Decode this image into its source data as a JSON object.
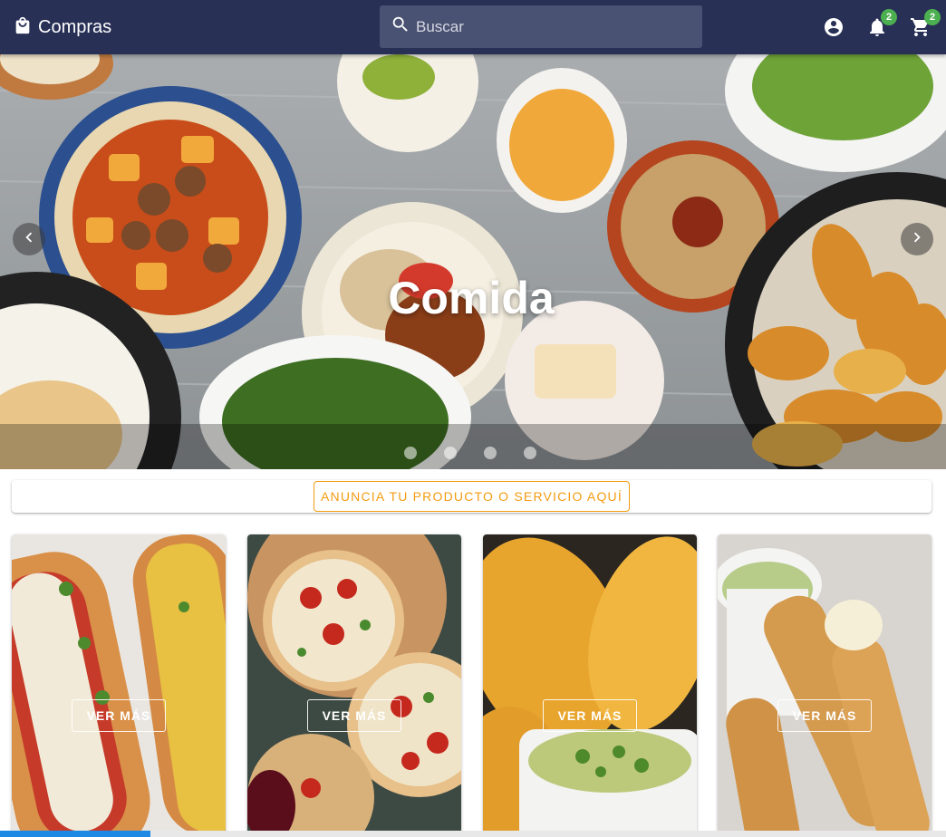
{
  "app": {
    "title": "Compras",
    "icons": {
      "brand": "shopping-bag-icon",
      "search": "search-icon",
      "account": "account-circle-icon",
      "notifications": "bell-icon",
      "cart": "cart-icon"
    },
    "search_placeholder": "Buscar",
    "notifications_count": "2",
    "cart_count": "2",
    "colors": {
      "appbar": "#283056",
      "badge": "#4caf50",
      "accent": "#f39c12"
    }
  },
  "hero": {
    "title": "Comida",
    "prev_icon": "chevron-left-icon",
    "next_icon": "chevron-right-icon",
    "slides": 4
  },
  "ad": {
    "label": "ANUNCIA TU PRODUCTO O SERVICIO AQUÍ"
  },
  "cards": [
    {
      "button": "VER MÁS"
    },
    {
      "button": "VER MÁS"
    },
    {
      "button": "VER MÁS"
    },
    {
      "button": "VER MÁS"
    }
  ]
}
